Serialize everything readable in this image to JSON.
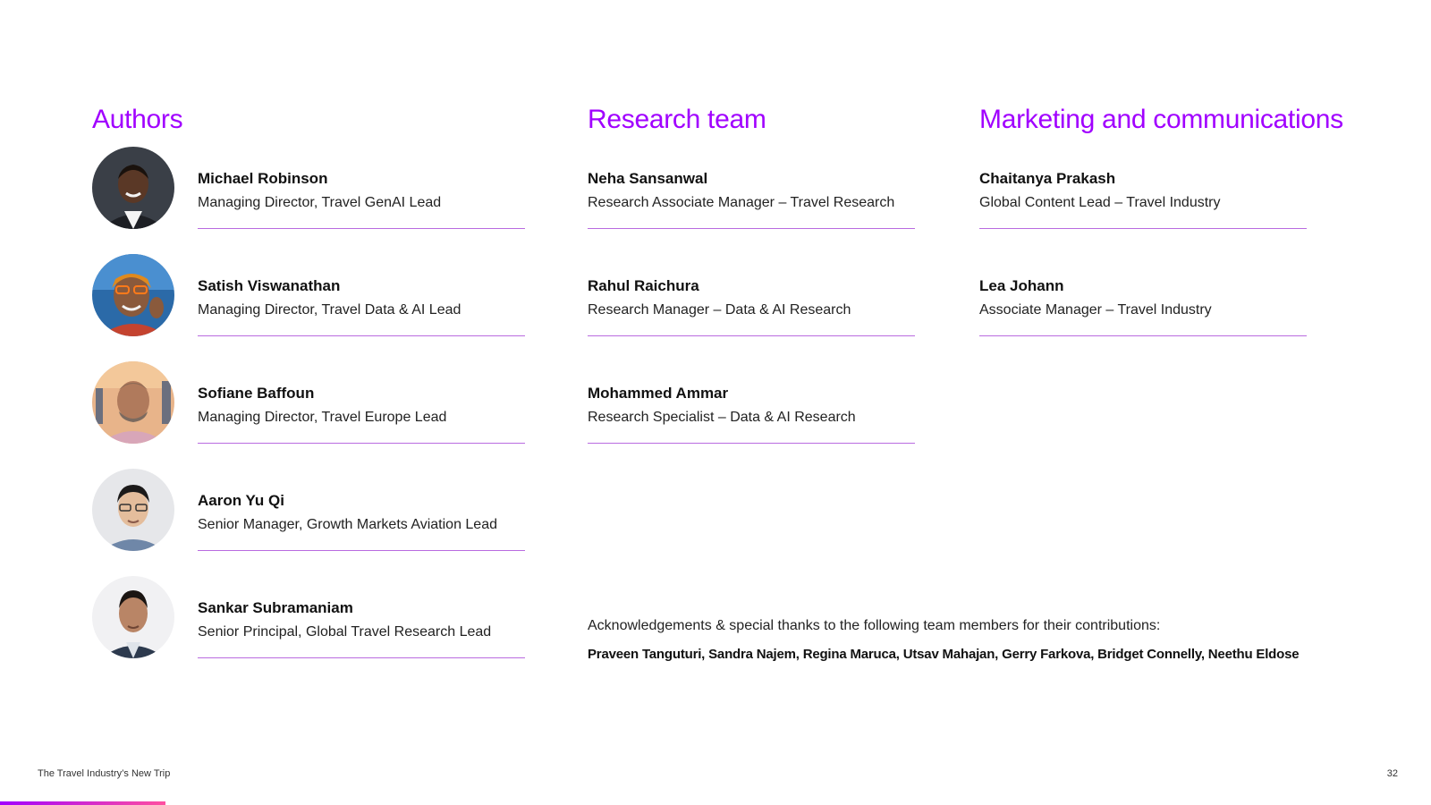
{
  "sections": {
    "authors": {
      "heading": "Authors",
      "people": [
        {
          "name": "Michael Robinson",
          "role": "Managing Director, Travel GenAI Lead",
          "avatar": "portrait-photo"
        },
        {
          "name": "Satish Viswanathan",
          "role": "Managing Director, Travel Data & AI Lead",
          "avatar": "portrait-photo"
        },
        {
          "name": "Sofiane Baffoun",
          "role": "Managing Director, Travel Europe Lead",
          "avatar": "portrait-photo"
        },
        {
          "name": "Aaron Yu Qi",
          "role": "Senior Manager, Growth Markets Aviation Lead",
          "avatar": "portrait-photo"
        },
        {
          "name": "Sankar Subramaniam",
          "role": "Senior Principal, Global Travel Research Lead",
          "avatar": "portrait-photo"
        }
      ]
    },
    "research_team": {
      "heading": "Research team",
      "people": [
        {
          "name": "Neha Sansanwal",
          "role": "Research Associate Manager – Travel Research"
        },
        {
          "name": "Rahul Raichura",
          "role": "Research Manager – Data & AI Research"
        },
        {
          "name": "Mohammed Ammar",
          "role": "Research Specialist – Data & AI Research"
        }
      ]
    },
    "marketing": {
      "heading": "Marketing and communications",
      "people": [
        {
          "name": "Chaitanya Prakash",
          "role": "Global Content Lead – Travel Industry"
        },
        {
          "name": "Lea Johann",
          "role": "Associate Manager – Travel Industry"
        }
      ]
    }
  },
  "acknowledgements": {
    "intro": "Acknowledgements & special thanks to the following team members for their contributions:",
    "names": "Praveen Tanguturi, Sandra Najem, Regina Maruca, Utsav Mahajan, Gerry Farkova, Bridget Connelly, Neethu Eldose"
  },
  "footer": {
    "title": "The Travel Industry’s New Trip",
    "page_number": "32"
  },
  "colors": {
    "accent_purple": "#a100ff",
    "divider": "#b96be0",
    "text": "#111111",
    "background": "#ffffff"
  }
}
